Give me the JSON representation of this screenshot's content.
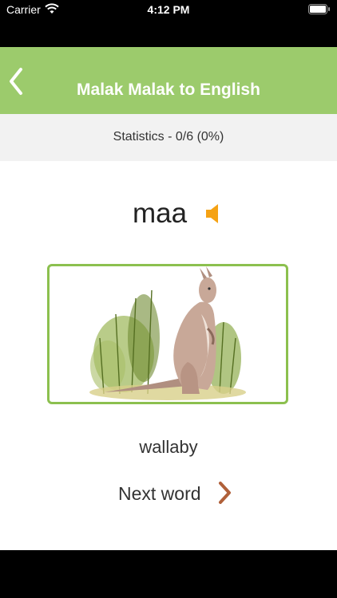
{
  "status_bar": {
    "carrier": "Carrier",
    "time": "4:12 PM",
    "icons": [
      "wifi-icon",
      "battery-icon"
    ]
  },
  "nav": {
    "title": "Malak Malak to English",
    "back_icon": "chevron-left-icon"
  },
  "stats": {
    "text": "Statistics - 0/6 (0%)"
  },
  "card": {
    "word": "maa",
    "speaker_icon": "speaker-icon",
    "image_subject": "wallaby-illustration",
    "translation": "wallaby"
  },
  "next": {
    "label": "Next word",
    "icon": "chevron-right-icon"
  },
  "colors": {
    "nav_green": "#9ccb6c",
    "frame_green": "#8cc04f",
    "speaker_orange": "#f5a214",
    "chevron_brown": "#b0603a"
  }
}
